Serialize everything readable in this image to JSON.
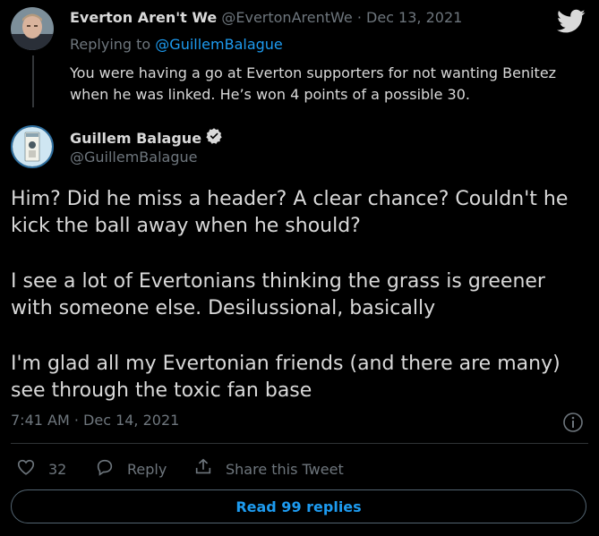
{
  "reply_tweet": {
    "display_name": "Everton Aren't We",
    "handle": "@EvertonArentWe",
    "date": "Dec 13, 2021",
    "replying_to_prefix": "Replying to",
    "replying_to_handle": "@GuillemBalague",
    "text": "You were having a go at Everton supporters for not wanting Benitez when he was linked. He’s won 4 points of a possible 30."
  },
  "main_tweet": {
    "display_name": "Guillem Balague",
    "handle": "@GuillemBalague",
    "paragraphs": [
      "Him? Did he miss a header? A clear chance? Couldn't he kick the ball away when he should?",
      "I see a lot of Evertonians thinking the grass is greener with someone else. Desilussional, basically",
      "I'm glad all my Evertonian friends (and there are many) see through the toxic fan base"
    ],
    "timestamp": "7:41 AM · Dec 14, 2021",
    "like_count": "32",
    "reply_label": "Reply",
    "share_label": "Share this Tweet"
  },
  "read_replies_label": "Read 99 replies",
  "colors": {
    "background": "#000000",
    "accent": "#1d9bf0",
    "muted": "#6e767d"
  },
  "icons": [
    "twitter-bird-icon",
    "verified-badge-icon",
    "info-icon",
    "heart-icon",
    "reply-bubble-icon",
    "share-icon"
  ]
}
